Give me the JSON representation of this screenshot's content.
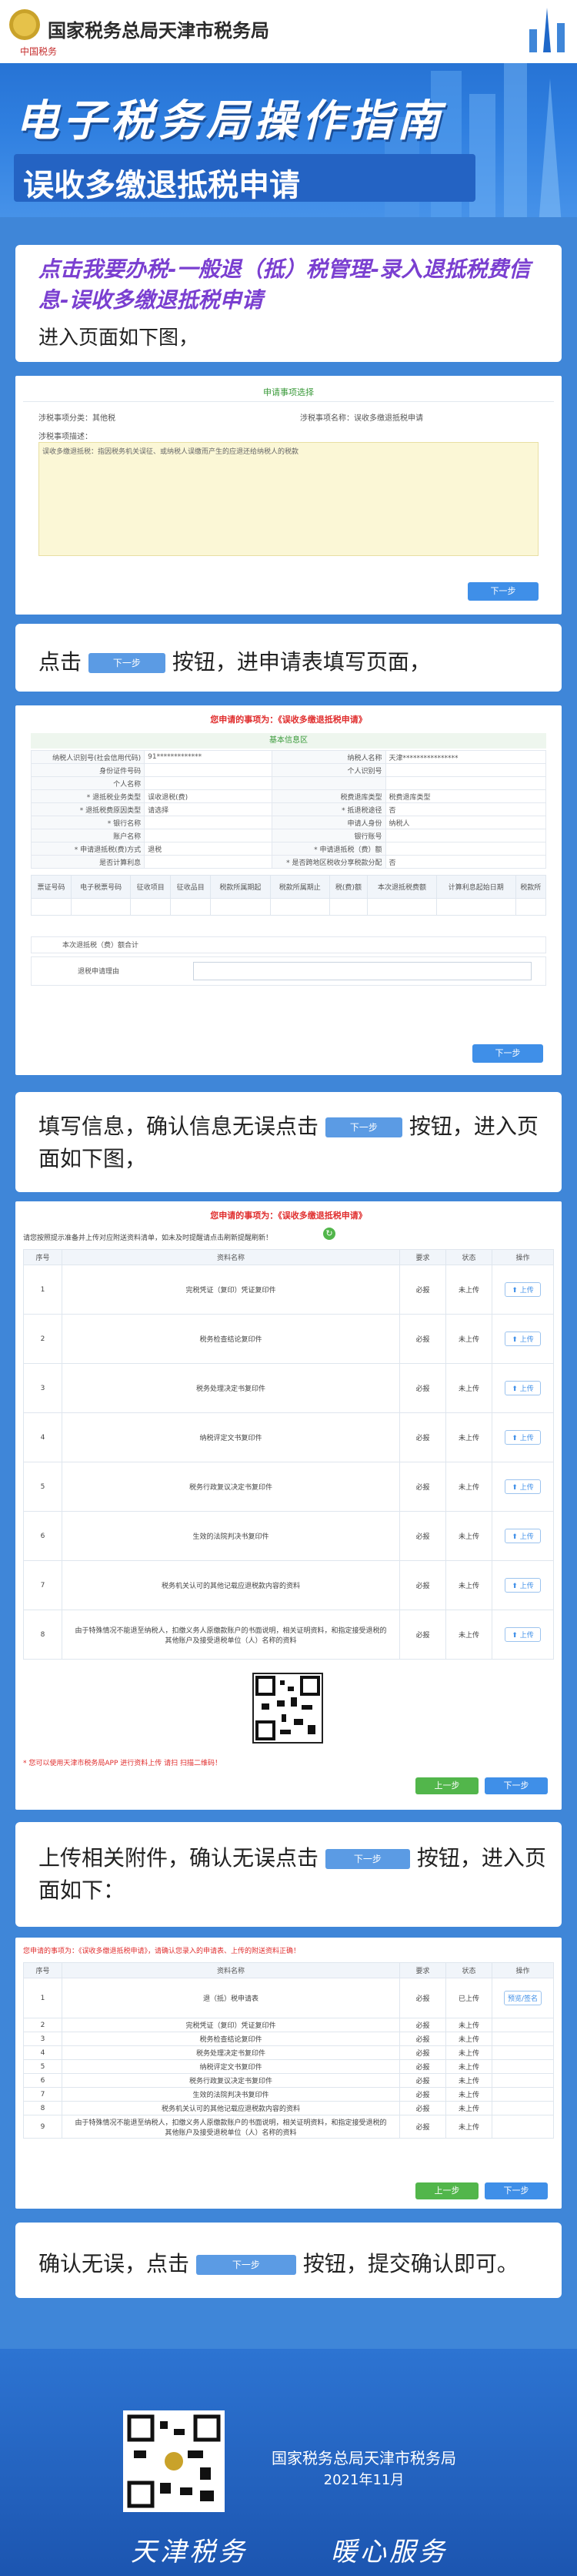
{
  "header": {
    "org_name": "国家税务总局天津市税务局",
    "brand_mini": "中国税务",
    "title": "电子税务局操作指南",
    "subtitle": "误收多缴退抵税申请"
  },
  "intro": {
    "path": "点击我要办税-一般退（抵）税管理-录入退抵税费信息-误收多缴退抵税申请",
    "line": "进入页面如下图，"
  },
  "screen1": {
    "section_title": "申请事项选择",
    "left_label": "涉税事项分类：其他税",
    "right_label": "涉税事项名称：误收多缴退抵税申请",
    "desc_label": "涉税事项描述：",
    "desc_text": "误收多缴退抵税：指因税务机关误征、或纳税人误缴而产生的应退还给纳税人的税款",
    "next_btn": "下一步"
  },
  "step1": {
    "prefix": "点击",
    "btn": "下一步",
    "suffix": "按钮，进申请表填写页面，"
  },
  "screen2": {
    "title": "您申请的事项为：《误收多缴退抵税申请》",
    "section": "基本信息区",
    "rows": [
      [
        "纳税人识别号(社会信用代码)",
        "91*************",
        "纳税人名称",
        "天津****************"
      ],
      [
        "身份证件号码",
        "",
        "个人识别号",
        ""
      ],
      [
        "个人名称",
        "",
        "",
        ""
      ],
      [
        "* 退抵税业务类型",
        "误收退税(费)",
        "税费退库类型",
        "税费退库类型"
      ],
      [
        "* 退抵税费原因类型",
        "请选择",
        "* 抵退税途径",
        "否"
      ],
      [
        "* 银行名称",
        "",
        "申请人身份",
        "纳税人"
      ],
      [
        "账户名称",
        "",
        "银行账号",
        ""
      ],
      [
        "* 申请退抵税(费)方式",
        "退税",
        "* 申请退抵税（费）额",
        ""
      ],
      [
        "是否计算利息",
        "",
        "* 是否跨地区税收分享税款分配",
        "否"
      ]
    ],
    "detail_headers": [
      "票证号码",
      "电子税票号码",
      "征收项目",
      "征收品目",
      "税款所属期起",
      "税款所属期止",
      "税(费)额",
      "本次退抵税费额",
      "计算利息起始日期",
      "税款所"
    ],
    "sum_label": "本次退抵税（费）额合计",
    "reason_label": "退税申请理由",
    "next_btn": "下一步"
  },
  "step2": {
    "prefix": "填写信息，确认信息无误点击",
    "btn": "下一步",
    "suffix": "按钮，进入页面如下图，"
  },
  "screen3": {
    "title": "您申请的事项为：《误收多缴退抵税申请》",
    "hint": "请您按照提示准备并上传对应附送资料清单，如未及时提醒请点击刷新提醒刷新！",
    "headers": [
      "序号",
      "资料名称",
      "要求",
      "状态",
      "操作"
    ],
    "rows": [
      [
        "1",
        "完税凭证（复印）凭证复印件",
        "必报",
        "未上传",
        "上传"
      ],
      [
        "2",
        "税务检查结论复印件",
        "必报",
        "未上传",
        "上传"
      ],
      [
        "3",
        "税务处理决定书复印件",
        "必报",
        "未上传",
        "上传"
      ],
      [
        "4",
        "纳税评定文书复印件",
        "必报",
        "未上传",
        "上传"
      ],
      [
        "5",
        "税务行政复议决定书复印件",
        "必报",
        "未上传",
        "上传"
      ],
      [
        "6",
        "生效的法院判决书复印件",
        "必报",
        "未上传",
        "上传"
      ],
      [
        "7",
        "税务机关认可的其他记载应退税款内容的资料",
        "必报",
        "未上传",
        "上传"
      ],
      [
        "8",
        "由于特殊情况不能退至纳税人，扣缴义务人原缴款账户的书面说明，相关证明资料，和指定接受退税的其他账户及接受退税单位（人）名称的资料",
        "必报",
        "未上传",
        "上传"
      ]
    ],
    "qr_hint": "* 您可以使用天津市税务局APP 进行资料上传 请扫 扫描二维码！",
    "prev_btn": "上一步",
    "next_btn": "下一步"
  },
  "step3": {
    "prefix": "上传相关附件，确认无误点击",
    "btn": "下一步",
    "suffix": "按钮，进入页面如下："
  },
  "screen4": {
    "title": "您申请的事项为：《误收多缴退抵税申请》，请确认您录入的申请表、上传的附送资料正确！",
    "headers": [
      "序号",
      "资料名称",
      "要求",
      "状态",
      "操作"
    ],
    "rows": [
      [
        "1",
        "退（抵）税申请表",
        "必报",
        "已上传",
        "预览/签名"
      ],
      [
        "2",
        "完税凭证（复印）凭证复印件",
        "必报",
        "未上传",
        ""
      ],
      [
        "3",
        "税务检查结论复印件",
        "必报",
        "未上传",
        ""
      ],
      [
        "4",
        "税务处理决定书复印件",
        "必报",
        "未上传",
        ""
      ],
      [
        "5",
        "纳税评定文书复印件",
        "必报",
        "未上传",
        ""
      ],
      [
        "6",
        "税务行政复议决定书复印件",
        "必报",
        "未上传",
        ""
      ],
      [
        "7",
        "生效的法院判决书复印件",
        "必报",
        "未上传",
        ""
      ],
      [
        "8",
        "税务机关认可的其他记载应退税款内容的资料",
        "必报",
        "未上传",
        ""
      ],
      [
        "9",
        "由于特殊情况不能退至纳税人，扣缴义务人原缴款账户的书面说明，相关证明资料，和指定接受退税的其他账户及接受退税单位（人）名称的资料",
        "必报",
        "未上传",
        ""
      ]
    ],
    "prev_btn": "上一步",
    "next_btn": "下一步"
  },
  "step4": {
    "prefix": "确认无误，点击",
    "btn": "下一步",
    "suffix": "按钮，提交确认即可。"
  },
  "footer": {
    "org": "国家税务总局天津市税务局",
    "date": "2021年11月",
    "slogan_left": "天津税务",
    "slogan_right": "暖心服务"
  },
  "colors": {
    "page_blue": "#3f86d8",
    "title_purple": "#7a3fd0",
    "required_red": "#e02d2d",
    "button_blue": "#3f8fe8",
    "button_green": "#52b64b"
  }
}
